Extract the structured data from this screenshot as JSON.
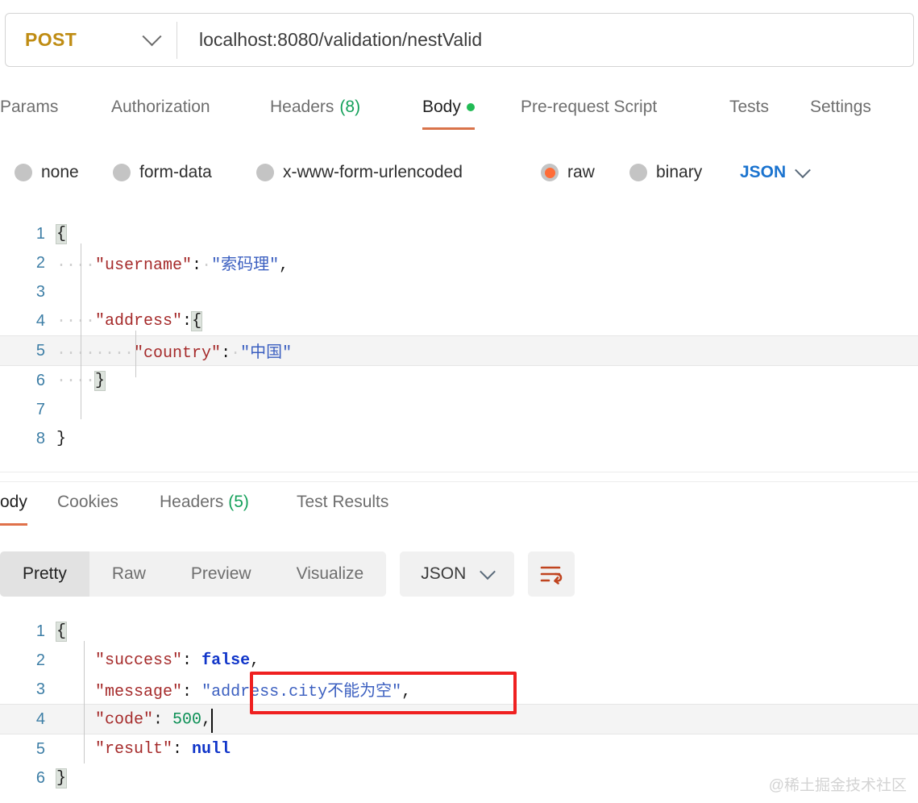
{
  "request_bar": {
    "method": "POST",
    "method_chevron_icon": "chevron-down-icon",
    "url": "localhost:8080/validation/nestValid"
  },
  "request_tabs": [
    {
      "label": "Params",
      "count": "",
      "active": false,
      "dot": false
    },
    {
      "label": "Authorization",
      "count": "",
      "active": false,
      "dot": false
    },
    {
      "label": "Headers",
      "count": "(8)",
      "active": false,
      "dot": false
    },
    {
      "label": "Body",
      "count": "",
      "active": true,
      "dot": true
    },
    {
      "label": "Pre-request Script",
      "count": "",
      "active": false,
      "dot": false
    },
    {
      "label": "Tests",
      "count": "",
      "active": false,
      "dot": false
    },
    {
      "label": "Settings",
      "count": "",
      "active": false,
      "dot": false
    }
  ],
  "body_types": {
    "options": [
      {
        "label": "none",
        "selected": false
      },
      {
        "label": "form-data",
        "selected": false
      },
      {
        "label": "x-www-form-urlencoded",
        "selected": false
      },
      {
        "label": "raw",
        "selected": true
      },
      {
        "label": "binary",
        "selected": false
      }
    ],
    "format": "JSON",
    "format_chevron_icon": "chevron-down-icon"
  },
  "request_body": {
    "lines": [
      {
        "num": "1",
        "highlight": false,
        "tokens": [
          {
            "t": "{",
            "c": "p brace-hl"
          }
        ]
      },
      {
        "num": "2",
        "highlight": false,
        "tokens": [
          {
            "t": "····",
            "c": "ws"
          },
          {
            "t": "\"username\"",
            "c": "k"
          },
          {
            "t": ":",
            "c": "p"
          },
          {
            "t": "·",
            "c": "ws"
          },
          {
            "t": "\"索码理\"",
            "c": "s"
          },
          {
            "t": ",",
            "c": "p"
          }
        ]
      },
      {
        "num": "3",
        "highlight": false,
        "tokens": []
      },
      {
        "num": "4",
        "highlight": false,
        "tokens": [
          {
            "t": "····",
            "c": "ws"
          },
          {
            "t": "\"address\"",
            "c": "k"
          },
          {
            "t": ":",
            "c": "p"
          },
          {
            "t": "{",
            "c": "p brace-hl"
          }
        ]
      },
      {
        "num": "5",
        "highlight": true,
        "tokens": [
          {
            "t": "····",
            "c": "ws"
          },
          {
            "t": "····",
            "c": "ws"
          },
          {
            "t": "\"country\"",
            "c": "k"
          },
          {
            "t": ":",
            "c": "p"
          },
          {
            "t": "·",
            "c": "ws"
          },
          {
            "t": "\"中国\"",
            "c": "s"
          }
        ]
      },
      {
        "num": "6",
        "highlight": false,
        "tokens": [
          {
            "t": "····",
            "c": "ws"
          },
          {
            "t": "}",
            "c": "p brace-hl"
          }
        ]
      },
      {
        "num": "7",
        "highlight": false,
        "tokens": []
      },
      {
        "num": "8",
        "highlight": false,
        "tokens": [
          {
            "t": "}",
            "c": "p"
          }
        ]
      }
    ]
  },
  "response_tabs": [
    {
      "label": "ody",
      "count": "",
      "active": true
    },
    {
      "label": "Cookies",
      "count": "",
      "active": false
    },
    {
      "label": "Headers",
      "count": "(5)",
      "active": false
    },
    {
      "label": "Test Results",
      "count": "",
      "active": false
    }
  ],
  "response_view": {
    "segments": [
      {
        "label": "Pretty",
        "active": true
      },
      {
        "label": "Raw",
        "active": false
      },
      {
        "label": "Preview",
        "active": false
      },
      {
        "label": "Visualize",
        "active": false
      }
    ],
    "format": "JSON",
    "format_chevron_icon": "chevron-down-icon",
    "wrap_icon": "word-wrap-icon"
  },
  "response_body": {
    "lines": [
      {
        "num": "1",
        "highlight": false,
        "tokens": [
          {
            "t": "{",
            "c": "p brace-hl"
          }
        ]
      },
      {
        "num": "2",
        "highlight": false,
        "tokens": [
          {
            "t": "    ",
            "c": "p"
          },
          {
            "t": "\"success\"",
            "c": "k"
          },
          {
            "t": ": ",
            "c": "p"
          },
          {
            "t": "false",
            "c": "b"
          },
          {
            "t": ",",
            "c": "p"
          }
        ]
      },
      {
        "num": "3",
        "highlight": false,
        "tokens": [
          {
            "t": "    ",
            "c": "p"
          },
          {
            "t": "\"message\"",
            "c": "k"
          },
          {
            "t": ": ",
            "c": "p"
          },
          {
            "t": "\"address.city不能为空\"",
            "c": "s"
          },
          {
            "t": ",",
            "c": "p"
          }
        ]
      },
      {
        "num": "4",
        "highlight": true,
        "tokens": [
          {
            "t": "    ",
            "c": "p"
          },
          {
            "t": "\"code\"",
            "c": "k"
          },
          {
            "t": ": ",
            "c": "p"
          },
          {
            "t": "500",
            "c": "n"
          },
          {
            "t": ",",
            "c": "p"
          }
        ]
      },
      {
        "num": "5",
        "highlight": false,
        "tokens": [
          {
            "t": "    ",
            "c": "p"
          },
          {
            "t": "\"result\"",
            "c": "k"
          },
          {
            "t": ": ",
            "c": "p"
          },
          {
            "t": "null",
            "c": "b"
          }
        ]
      },
      {
        "num": "6",
        "highlight": false,
        "tokens": [
          {
            "t": "}",
            "c": "p brace-hl"
          }
        ]
      }
    ]
  },
  "annotation": {
    "name": "message-value-highlight",
    "color": "#ef2020"
  },
  "watermark": "@稀土掘金技术社区",
  "colors": {
    "method": "#bf8c13",
    "accent_orange": "#ff6c37",
    "tab_underline": "#d9734a",
    "json_blue": "#1a73cf",
    "green_dot": "#22bb55",
    "count_green": "#14a05a",
    "line_number": "#3d7ea6",
    "json_key": "#a52a2a",
    "json_string": "#3b5fc0",
    "json_bool": "#1035c9",
    "json_number": "#0b8f55",
    "annotation_red": "#ef2020"
  }
}
